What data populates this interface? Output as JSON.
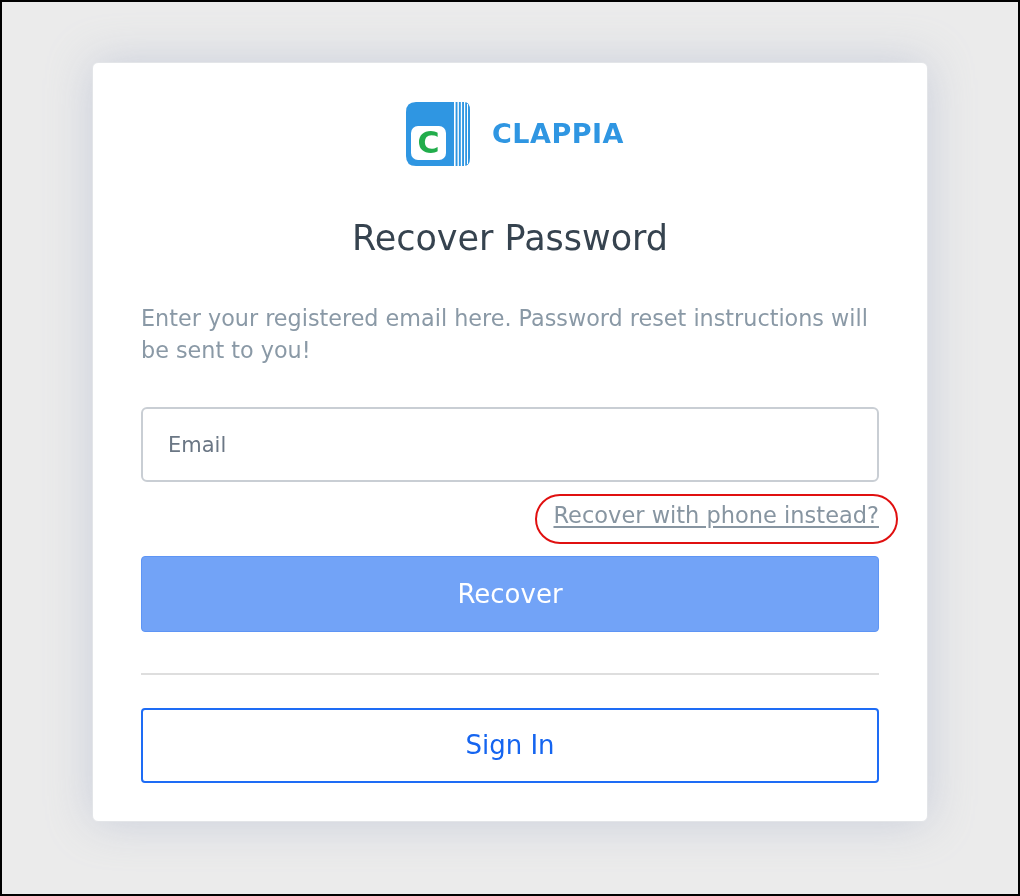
{
  "logo": {
    "mark": "C",
    "name": "CLAPPIA"
  },
  "title": "Recover Password",
  "description": "Enter your registered email here. Password reset instructions will be sent to you!",
  "email_field": {
    "placeholder": "Email"
  },
  "alt_link": {
    "label": "Recover with phone instead?",
    "highlighted": true
  },
  "primary_button": {
    "label": "Recover"
  },
  "secondary_button": {
    "label": "Sign In"
  }
}
